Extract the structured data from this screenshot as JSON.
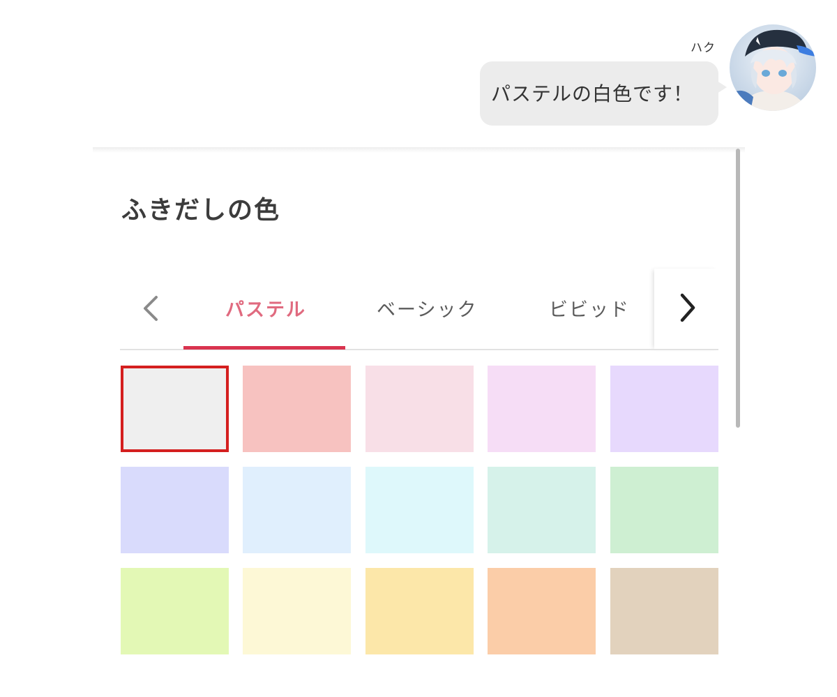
{
  "chat": {
    "speaker_name": "ハク",
    "message": "パステルの白色です！"
  },
  "panel": {
    "title": "ふきだしの色"
  },
  "tabs": [
    {
      "label": "パステル",
      "active": true
    },
    {
      "label": "ベーシック",
      "active": false
    },
    {
      "label": "ビビッド",
      "active": false
    }
  ],
  "icons": {
    "prev": "chevron-left-icon",
    "next": "chevron-right-icon"
  },
  "colors": {
    "active_tab": "#e06a7f",
    "active_underline": "#d9344f",
    "selected_border": "#d41f1f",
    "bubble": "#ececec"
  },
  "swatches": [
    {
      "color": "#efefef",
      "selected": true
    },
    {
      "color": "#f7c2c0",
      "selected": false
    },
    {
      "color": "#f8dfe7",
      "selected": false
    },
    {
      "color": "#f6ddf6",
      "selected": false
    },
    {
      "color": "#e7d9fd",
      "selected": false
    },
    {
      "color": "#d9dbfc",
      "selected": false
    },
    {
      "color": "#e0effd",
      "selected": false
    },
    {
      "color": "#def8fb",
      "selected": false
    },
    {
      "color": "#d6f2ea",
      "selected": false
    },
    {
      "color": "#ceefd2",
      "selected": false
    },
    {
      "color": "#e3f8b5",
      "selected": false
    },
    {
      "color": "#fdf8d6",
      "selected": false
    },
    {
      "color": "#fce7a9",
      "selected": false
    },
    {
      "color": "#fbcda8",
      "selected": false
    },
    {
      "color": "#e2d2bd",
      "selected": false
    }
  ]
}
